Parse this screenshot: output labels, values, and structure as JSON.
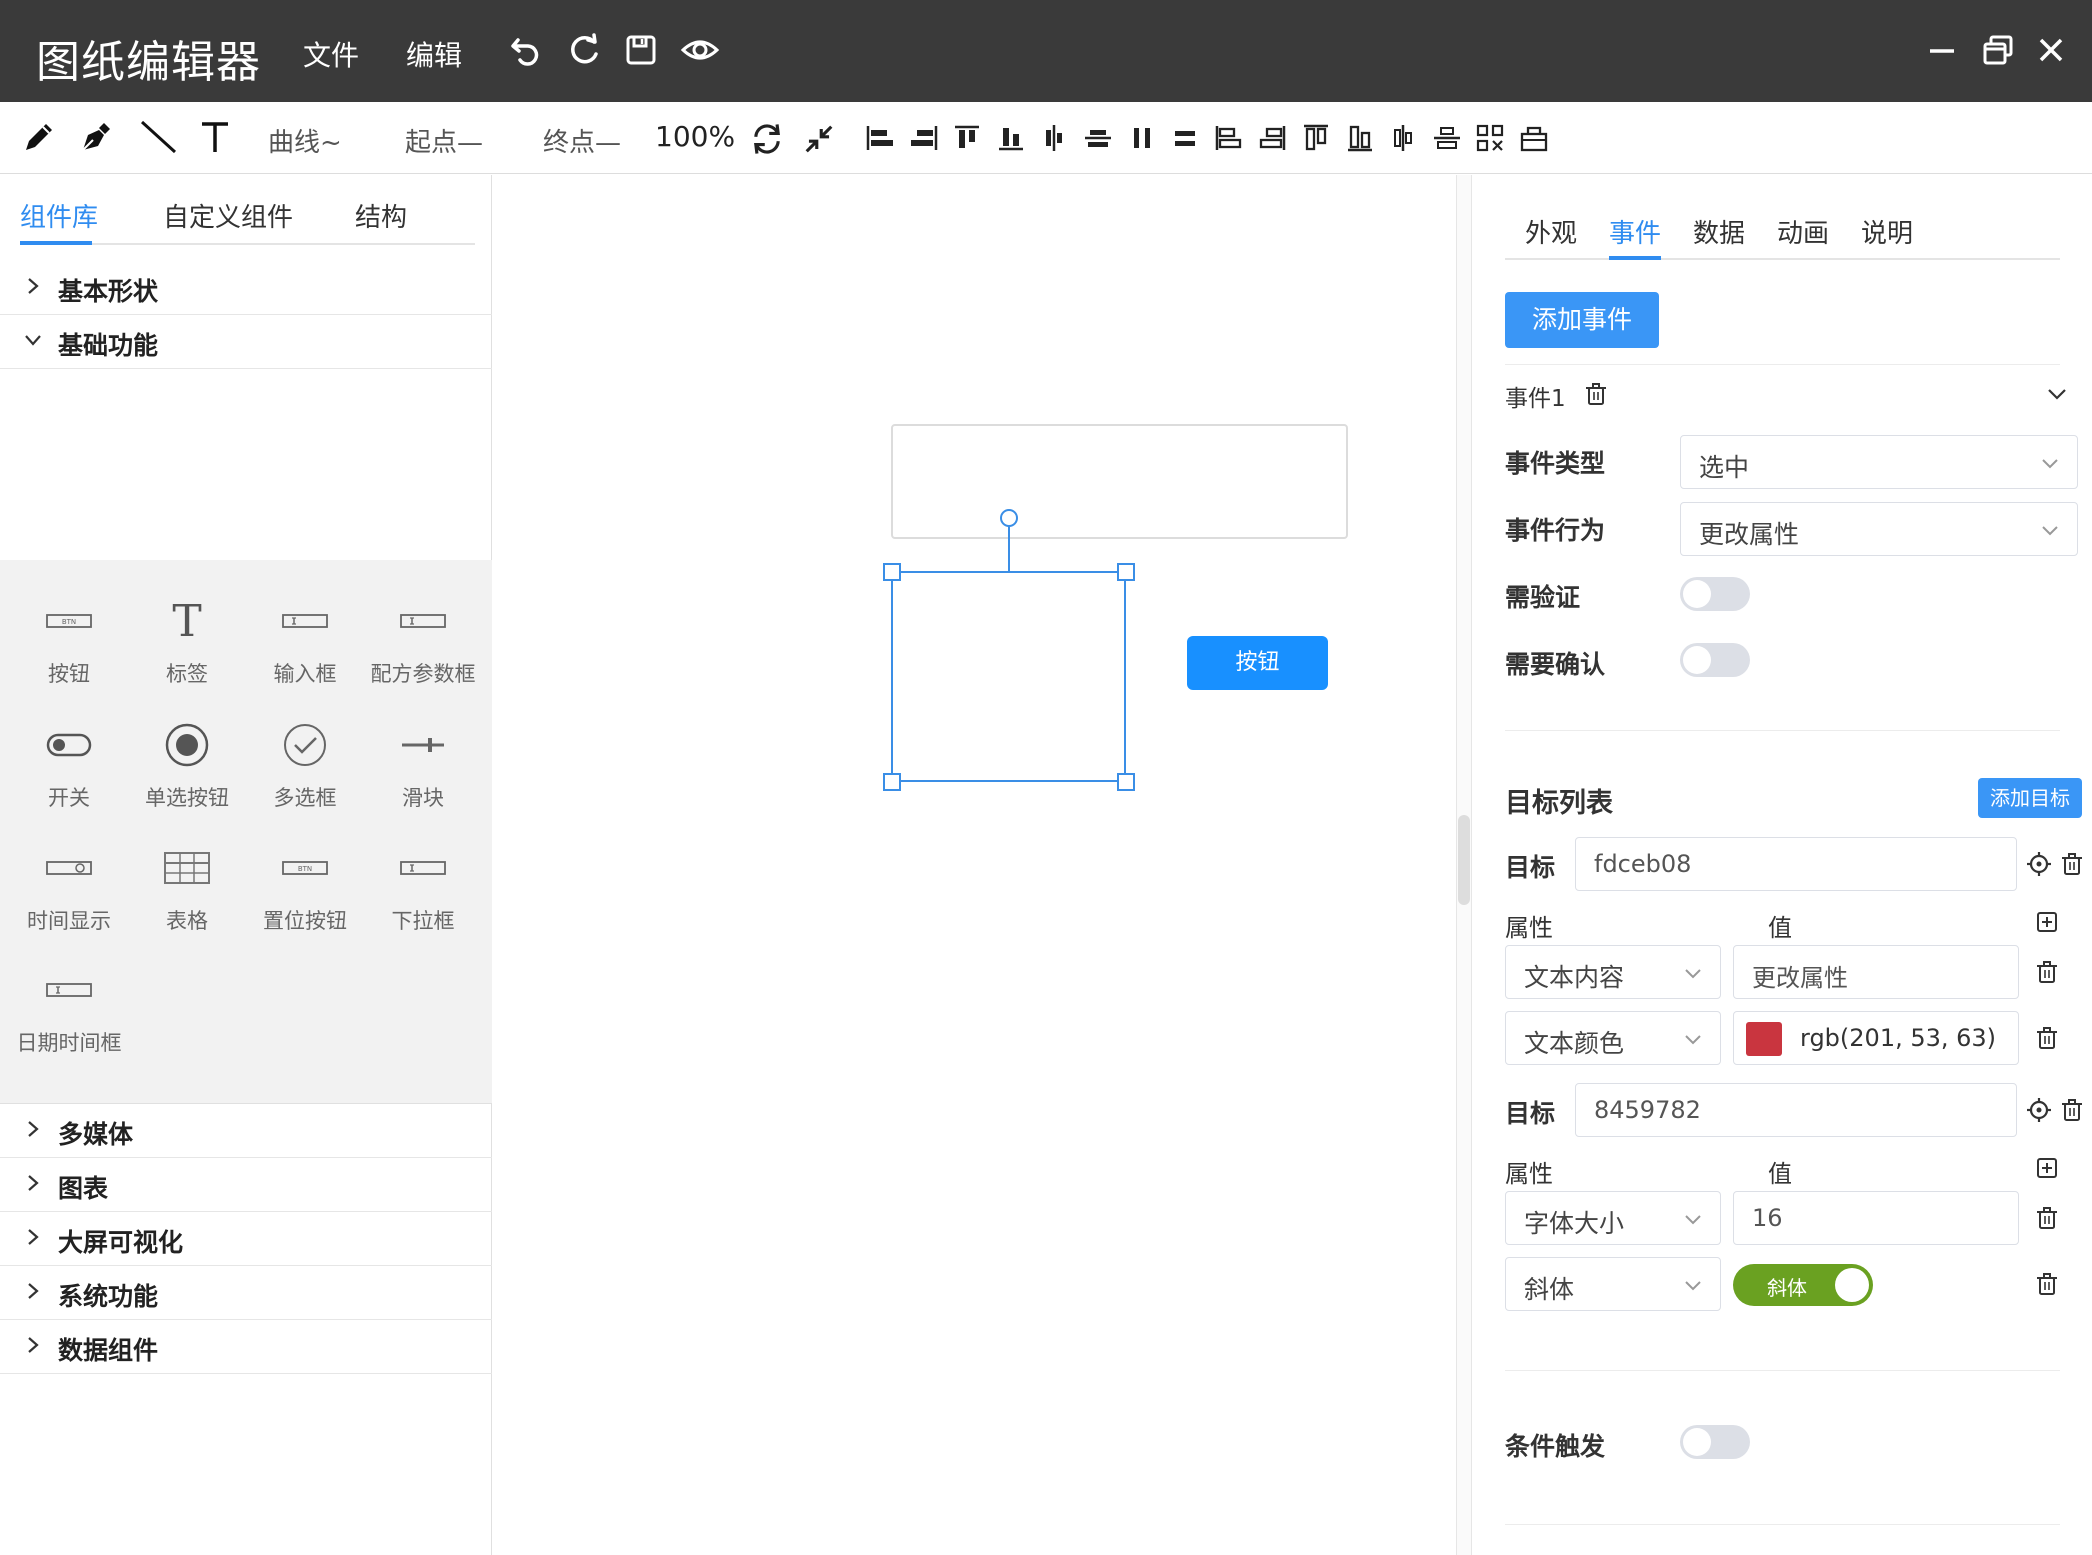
{
  "app": {
    "title": "图纸编辑器",
    "menus": [
      "文件",
      "编辑"
    ],
    "title_icons": [
      "undo-icon",
      "redo-icon",
      "save-icon",
      "preview-eye-icon"
    ],
    "window_controls": [
      "minimize-icon",
      "restore-icon",
      "close-icon"
    ]
  },
  "toolbar": {
    "tools": [
      "pencil-icon",
      "pen-icon",
      "line-icon",
      "text-tool-icon"
    ],
    "curve_label": "曲线~",
    "start_label": "起点—",
    "end_label": "终点—",
    "zoom": "100%",
    "align_icon_count": 17
  },
  "left": {
    "tabs": [
      "组件库",
      "自定义组件",
      "结构"
    ],
    "active_tab": 0,
    "categories_top": [
      {
        "label": "基本形状",
        "expanded": false
      },
      {
        "label": "基础功能",
        "expanded": true
      }
    ],
    "components": [
      {
        "label": "按钮",
        "icon": "button-widget-icon",
        "text": "BTN"
      },
      {
        "label": "标签",
        "icon": "label-text-icon",
        "text": "T"
      },
      {
        "label": "输入框",
        "icon": "input-box-icon"
      },
      {
        "label": "配方参数框",
        "icon": "recipe-param-icon"
      },
      {
        "label": "开关",
        "icon": "toggle-switch-icon"
      },
      {
        "label": "单选按钮",
        "icon": "radio-button-icon"
      },
      {
        "label": "多选框",
        "icon": "checkbox-icon"
      },
      {
        "label": "滑块",
        "icon": "slider-icon"
      },
      {
        "label": "时间显示",
        "icon": "time-display-icon"
      },
      {
        "label": "表格",
        "icon": "table-icon"
      },
      {
        "label": "置位按钮",
        "icon": "set-button-icon",
        "text": "BTN"
      },
      {
        "label": "下拉框",
        "icon": "dropdown-box-icon"
      },
      {
        "label": "日期时间框",
        "icon": "datetime-box-icon"
      }
    ],
    "categories_bottom": [
      "多媒体",
      "图表",
      "大屏可视化",
      "系统功能",
      "数据组件"
    ]
  },
  "canvas": {
    "button_label": "按钮",
    "button_color": "#1890ff",
    "selection_color": "#3a8ee6"
  },
  "right": {
    "tabs": [
      "外观",
      "事件",
      "数据",
      "动画",
      "说明"
    ],
    "active_tab": 1,
    "add_event_label": "添加事件",
    "event_title": "事件1",
    "event_type_label": "事件类型",
    "event_type_value": "选中",
    "event_action_label": "事件行为",
    "event_action_value": "更改属性",
    "need_verify_label": "需验证",
    "need_confirm_label": "需要确认",
    "target_list_label": "目标列表",
    "add_target_label": "添加目标",
    "targets": [
      {
        "label": "目标",
        "id": "fdceb08",
        "prop_header": "属性",
        "value_header": "值",
        "rows": [
          {
            "prop": "文本内容",
            "value": "更改属性",
            "kind": "text"
          },
          {
            "prop": "文本颜色",
            "value": "rgb(201, 53, 63)",
            "kind": "color",
            "swatch": "#c9353f"
          }
        ]
      },
      {
        "label": "目标",
        "id": "8459782",
        "prop_header": "属性",
        "value_header": "值",
        "rows": [
          {
            "prop": "字体大小",
            "value": "16",
            "kind": "text"
          },
          {
            "prop": "斜体",
            "value": "斜体",
            "kind": "switch",
            "on": true
          }
        ]
      }
    ],
    "condition_trigger_label": "条件触发",
    "accent_color": "#2f8cf0",
    "switch_on_color": "#6aa121"
  }
}
